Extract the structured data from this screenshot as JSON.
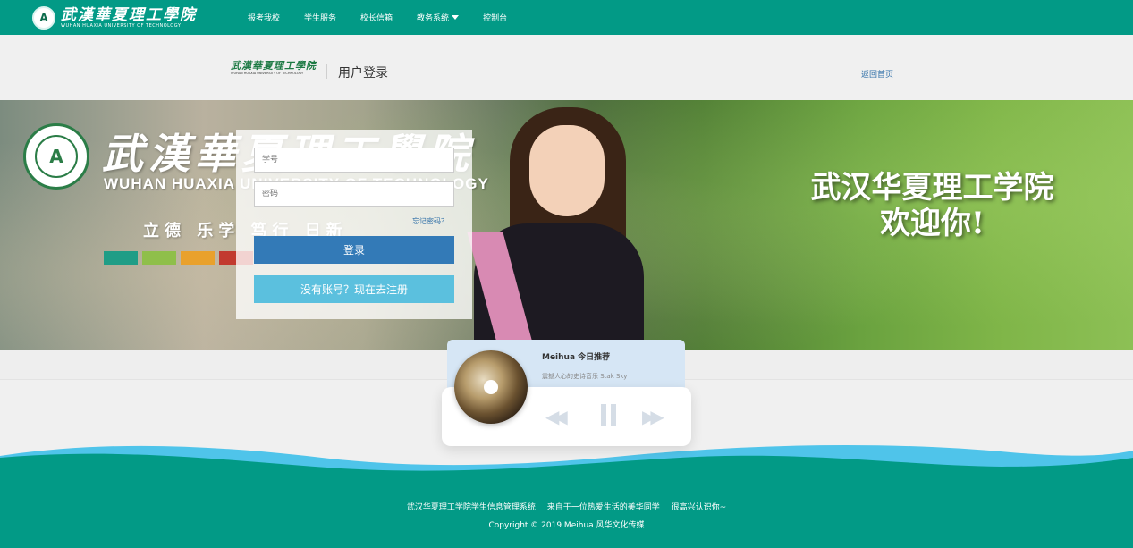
{
  "nav": {
    "logo_cn": "武漢華夏理工學院",
    "logo_en": "WUHAN HUAXIA UNIVERSITY OF TECHNOLOGY",
    "links": [
      "报考我校",
      "学生服务",
      "校长信箱",
      "教务系统",
      "控制台"
    ],
    "color": "#029a86"
  },
  "login_header": {
    "logo_cn": "武漢華夏理工學院",
    "logo_en": "WUHAN HUAXIA UNIVERSITY OF TECHNOLOGY",
    "title": "用户登录",
    "back_link": "返回首页"
  },
  "banner": {
    "school_cn": "武漢華夏理工學院",
    "school_en": "WUHAN HUAXIA UNIVERSITY OF TECHNOLOGY",
    "motto": "立德 乐学 笃行 日新",
    "welcome_line1": "武汉华夏理工学院",
    "welcome_line2": "欢迎你!",
    "bar_colors": [
      "#1f9d86",
      "#8fbf4a",
      "#e9a12c",
      "#c23a2f"
    ]
  },
  "login_form": {
    "student_id_placeholder": "学号",
    "password_placeholder": "密码",
    "forgot_link": "忘记密码？",
    "login_button": "登录",
    "register_button": "没有账号？现在去注册",
    "login_color": "#337ab7",
    "register_color": "#5bc0de"
  },
  "player": {
    "title": "Meihua 今日推荐",
    "subtitle": "震撼人心的史诗音乐 Stak Sky",
    "icons": [
      "prev-icon",
      "pause-icon",
      "next-icon"
    ]
  },
  "footer": {
    "line1_parts": [
      "武汉华夏理工学院学生信息管理系统",
      "来自于一位热爱生活的美华同学",
      "很高兴认识你~"
    ],
    "copyright": "Copyright © 2019 Meihua 风华文化传媒",
    "color": "#029a86"
  }
}
